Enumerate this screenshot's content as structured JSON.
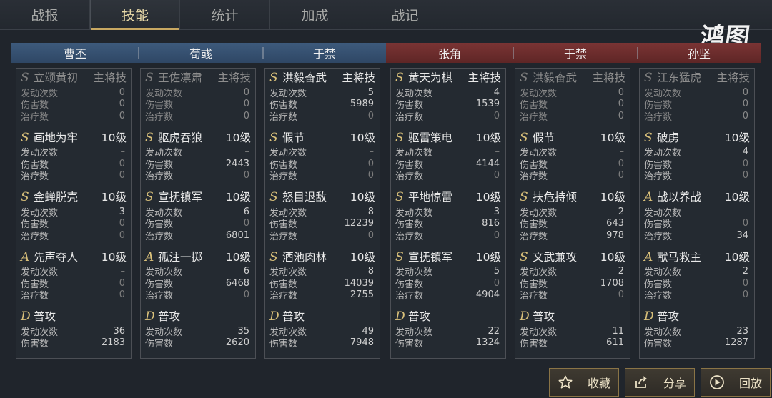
{
  "tabs": [
    "战报",
    "技能",
    "统计",
    "加成",
    "战记"
  ],
  "active_tab": 1,
  "logo": "鸿图",
  "labels": {
    "count": "发动次数",
    "damage": "伤害数",
    "heal": "治疗数"
  },
  "generals": [
    {
      "name": "曹丕",
      "side": "blue"
    },
    {
      "name": "荀彧",
      "side": "blue"
    },
    {
      "name": "于禁",
      "side": "blue"
    },
    {
      "name": "张角",
      "side": "red"
    },
    {
      "name": "于禁",
      "side": "red"
    },
    {
      "name": "孙坚",
      "side": "red"
    }
  ],
  "panels": [
    {
      "skills": [
        {
          "grade": "S",
          "name": "立颂黄初",
          "level": "主将技",
          "dim": true,
          "count": "0",
          "damage": "0",
          "heal": "0"
        },
        {
          "grade": "S",
          "name": "画地为牢",
          "level": "10级",
          "count": "–",
          "damage": "0",
          "heal": "0"
        },
        {
          "grade": "S",
          "name": "金蝉脱壳",
          "level": "10级",
          "count": "3",
          "damage": "0",
          "heal": "0"
        },
        {
          "grade": "A",
          "name": "先声夺人",
          "level": "10级",
          "count": "–",
          "damage": "0",
          "heal": "0"
        },
        {
          "grade": "D",
          "name": "普攻",
          "level": "",
          "count": "36",
          "damage": "2183"
        }
      ]
    },
    {
      "skills": [
        {
          "grade": "S",
          "name": "王佐凛肃",
          "level": "主将技",
          "dim": true,
          "count": "0",
          "damage": "0",
          "heal": "0"
        },
        {
          "grade": "S",
          "name": "驱虎吞狼",
          "level": "10级",
          "count": "–",
          "damage": "2443",
          "heal": "0"
        },
        {
          "grade": "S",
          "name": "宣抚镇军",
          "level": "10级",
          "count": "6",
          "damage": "0",
          "heal": "6801"
        },
        {
          "grade": "A",
          "name": "孤注一掷",
          "level": "10级",
          "count": "6",
          "damage": "6468",
          "heal": "0"
        },
        {
          "grade": "D",
          "name": "普攻",
          "level": "",
          "count": "35",
          "damage": "2620"
        }
      ]
    },
    {
      "skills": [
        {
          "grade": "S",
          "name": "洪毅奋武",
          "level": "主将技",
          "count": "5",
          "damage": "5989",
          "heal": "0"
        },
        {
          "grade": "S",
          "name": "假节",
          "level": "10级",
          "count": "–",
          "damage": "0",
          "heal": "0"
        },
        {
          "grade": "S",
          "name": "怒目退敌",
          "level": "10级",
          "count": "8",
          "damage": "12239",
          "heal": "0"
        },
        {
          "grade": "S",
          "name": "酒池肉林",
          "level": "10级",
          "count": "8",
          "damage": "14039",
          "heal": "2755"
        },
        {
          "grade": "D",
          "name": "普攻",
          "level": "",
          "count": "49",
          "damage": "7948"
        }
      ]
    },
    {
      "skills": [
        {
          "grade": "S",
          "name": "黄天为棋",
          "level": "主将技",
          "count": "4",
          "damage": "1539",
          "heal": "0"
        },
        {
          "grade": "S",
          "name": "驱雷策电",
          "level": "10级",
          "count": "–",
          "damage": "4144",
          "heal": "0"
        },
        {
          "grade": "S",
          "name": "平地惊雷",
          "level": "10级",
          "count": "3",
          "damage": "816",
          "heal": "0"
        },
        {
          "grade": "S",
          "name": "宣抚镇军",
          "level": "10级",
          "count": "5",
          "damage": "0",
          "heal": "4904"
        },
        {
          "grade": "D",
          "name": "普攻",
          "level": "",
          "count": "22",
          "damage": "1324"
        }
      ]
    },
    {
      "skills": [
        {
          "grade": "S",
          "name": "洪毅奋武",
          "level": "主将技",
          "dim": true,
          "count": "0",
          "damage": "0",
          "heal": "0"
        },
        {
          "grade": "S",
          "name": "假节",
          "level": "10级",
          "count": "–",
          "damage": "0",
          "heal": "0"
        },
        {
          "grade": "S",
          "name": "扶危持倾",
          "level": "10级",
          "count": "2",
          "damage": "643",
          "heal": "978"
        },
        {
          "grade": "S",
          "name": "文武兼攻",
          "level": "10级",
          "count": "2",
          "damage": "1708",
          "heal": "0"
        },
        {
          "grade": "D",
          "name": "普攻",
          "level": "",
          "count": "11",
          "damage": "611"
        }
      ]
    },
    {
      "skills": [
        {
          "grade": "S",
          "name": "江东猛虎",
          "level": "主将技",
          "dim": true,
          "count": "0",
          "damage": "0",
          "heal": "0"
        },
        {
          "grade": "S",
          "name": "破虏",
          "level": "10级",
          "count": "4",
          "damage": "0",
          "heal": "0"
        },
        {
          "grade": "A",
          "name": "战以养战",
          "level": "10级",
          "count": "–",
          "damage": "0",
          "heal": "34"
        },
        {
          "grade": "A",
          "name": "献马救主",
          "level": "10级",
          "count": "2",
          "damage": "0",
          "heal": "0"
        },
        {
          "grade": "D",
          "name": "普攻",
          "level": "",
          "count": "23",
          "damage": "1287"
        }
      ]
    }
  ],
  "buttons": [
    {
      "label": "收藏",
      "icon": "star-icon"
    },
    {
      "label": "分享",
      "icon": "share-icon"
    },
    {
      "label": "回放",
      "icon": "play-icon"
    }
  ]
}
